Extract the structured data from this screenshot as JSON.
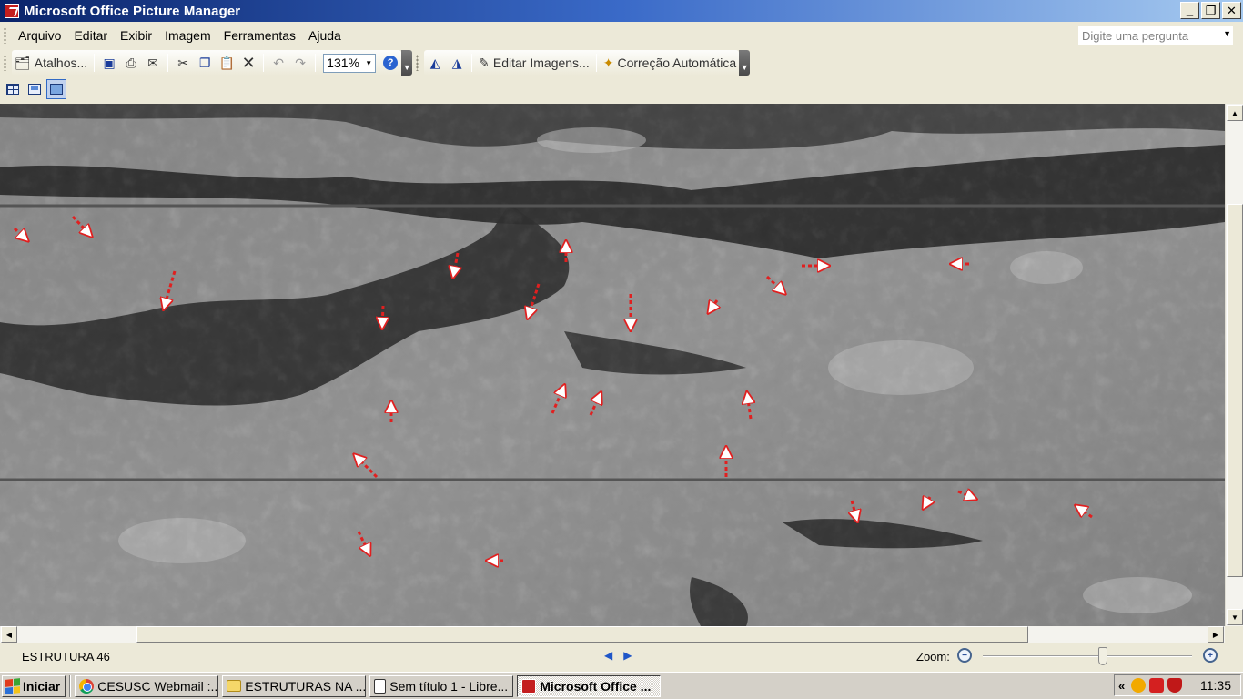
{
  "window": {
    "title": "Microsoft Office Picture Manager",
    "buttons": {
      "minimize": "_",
      "restore": "❐",
      "close": "✕"
    }
  },
  "menu": {
    "items": [
      "Arquivo",
      "Editar",
      "Exibir",
      "Imagem",
      "Ferramentas",
      "Ajuda"
    ],
    "ask_placeholder": "Digite uma pergunta"
  },
  "toolbar": {
    "shortcuts_label": "Atalhos...",
    "zoom_value": "131%",
    "edit_images_label": "Editar Imagens...",
    "auto_correct_label": "Correção Automática"
  },
  "image": {
    "description_icon": "lunar-surface-photo"
  },
  "status": {
    "file_name": "ESTRUTURA 46",
    "zoom_label": "Zoom:"
  },
  "taskbar": {
    "start_label": "Iniciar",
    "tasks": [
      "CESUSC Webmail :...",
      "ESTRUTURAS NA ...",
      "Sem título 1 - Libre...",
      "Microsoft Office ..."
    ],
    "clock": "11:35"
  },
  "colors": {
    "title_gradient_start": "#0a246a",
    "title_gradient_end": "#a6caf0",
    "arrow_color": "#e02020",
    "ui_background": "#ece9d8"
  }
}
